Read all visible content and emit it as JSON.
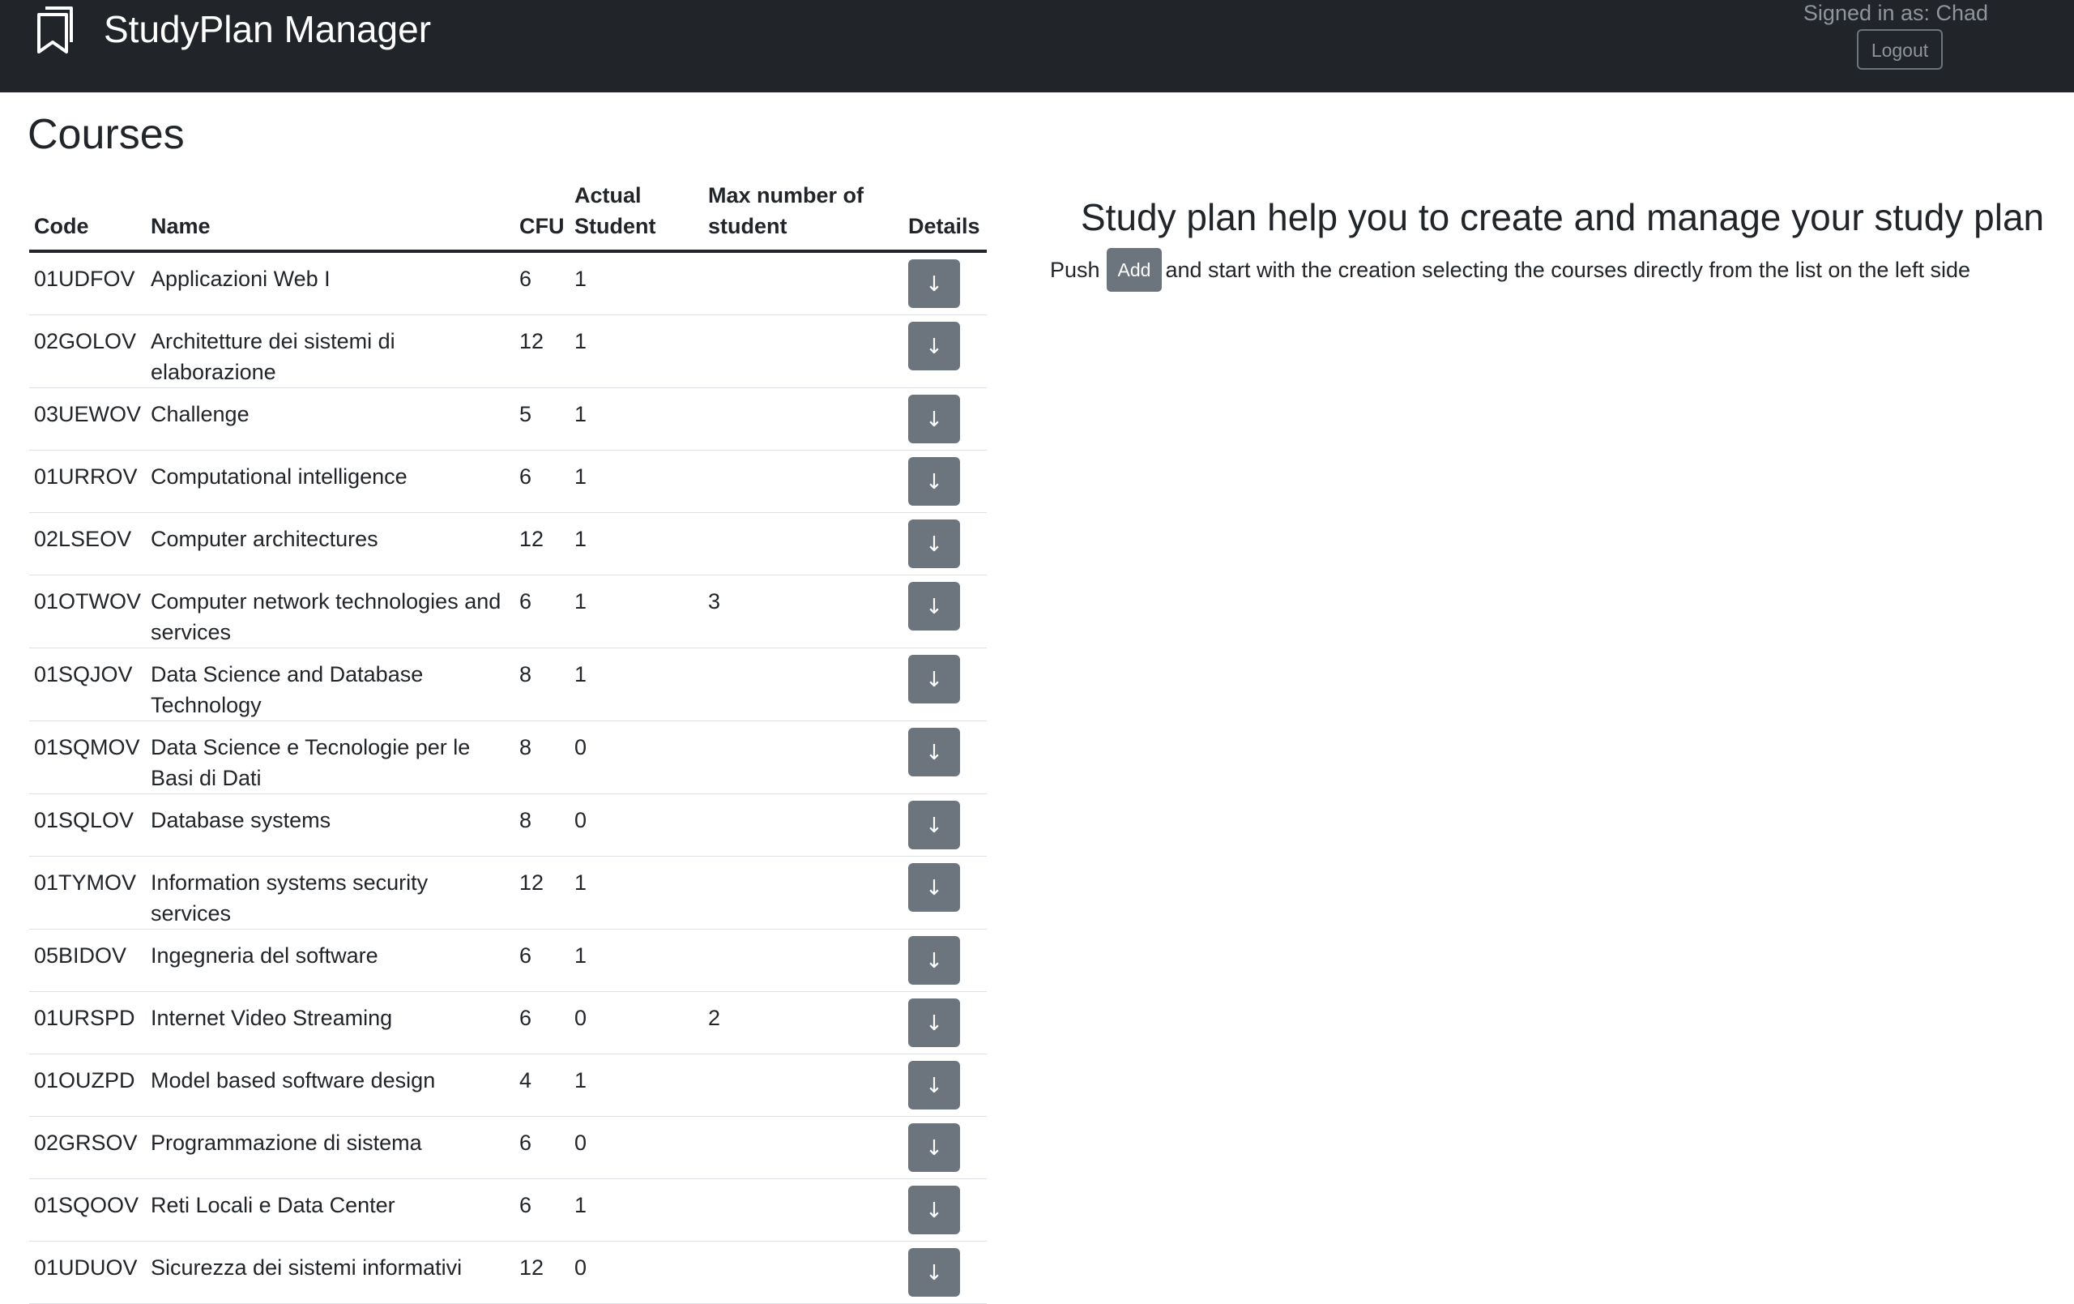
{
  "navbar": {
    "brand_icon": "bookmarks-icon",
    "title": "StudyPlan Manager",
    "signed_in_text": "Signed in as: Chad",
    "logout_label": "Logout"
  },
  "courses": {
    "title": "Courses",
    "columns": {
      "code": "Code",
      "name": "Name",
      "cfu": "CFU",
      "actual_students": "Actual Student",
      "max_students": "Max number of student",
      "details": "Details"
    },
    "details_icon": "arrow-down-icon",
    "details_glyph": "↓",
    "rows": [
      {
        "code": "01UDFOV",
        "name": "Applicazioni Web I",
        "cfu": "6",
        "actual": "1",
        "max": ""
      },
      {
        "code": "02GOLOV",
        "name": "Architetture dei sistemi di elaborazione",
        "cfu": "12",
        "actual": "1",
        "max": ""
      },
      {
        "code": "03UEWOV",
        "name": "Challenge",
        "cfu": "5",
        "actual": "1",
        "max": ""
      },
      {
        "code": "01URROV",
        "name": "Computational intelligence",
        "cfu": "6",
        "actual": "1",
        "max": ""
      },
      {
        "code": "02LSEOV",
        "name": "Computer architectures",
        "cfu": "12",
        "actual": "1",
        "max": ""
      },
      {
        "code": "01OTWOV",
        "name": "Computer network technologies and services",
        "cfu": "6",
        "actual": "1",
        "max": "3"
      },
      {
        "code": "01SQJOV",
        "name": "Data Science and Database Technology",
        "cfu": "8",
        "actual": "1",
        "max": ""
      },
      {
        "code": "01SQMOV",
        "name": "Data Science e Tecnologie per le Basi di Dati",
        "cfu": "8",
        "actual": "0",
        "max": ""
      },
      {
        "code": "01SQLOV",
        "name": "Database systems",
        "cfu": "8",
        "actual": "0",
        "max": ""
      },
      {
        "code": "01TYMOV",
        "name": "Information systems security services",
        "cfu": "12",
        "actual": "1",
        "max": ""
      },
      {
        "code": "05BIDOV",
        "name": "Ingegneria del software",
        "cfu": "6",
        "actual": "1",
        "max": ""
      },
      {
        "code": "01URSPD",
        "name": "Internet Video Streaming",
        "cfu": "6",
        "actual": "0",
        "max": "2"
      },
      {
        "code": "01OUZPD",
        "name": "Model based software design",
        "cfu": "4",
        "actual": "1",
        "max": ""
      },
      {
        "code": "02GRSOV",
        "name": "Programmazione di sistema",
        "cfu": "6",
        "actual": "0",
        "max": ""
      },
      {
        "code": "01SQOOV",
        "name": "Reti Locali e Data Center",
        "cfu": "6",
        "actual": "1",
        "max": ""
      },
      {
        "code": "01UDUOV",
        "name": "Sicurezza dei sistemi informativi",
        "cfu": "12",
        "actual": "0",
        "max": ""
      }
    ]
  },
  "info": {
    "title": "Study plan help you to create and manage your study plan",
    "push_text": "Push",
    "add_label": "Add",
    "rest_text": "and start with the creation selecting the courses directly from the list on the left side"
  },
  "colors": {
    "navbar_bg": "#212529",
    "button_secondary": "#6c757d",
    "muted_text": "#8f959a"
  }
}
